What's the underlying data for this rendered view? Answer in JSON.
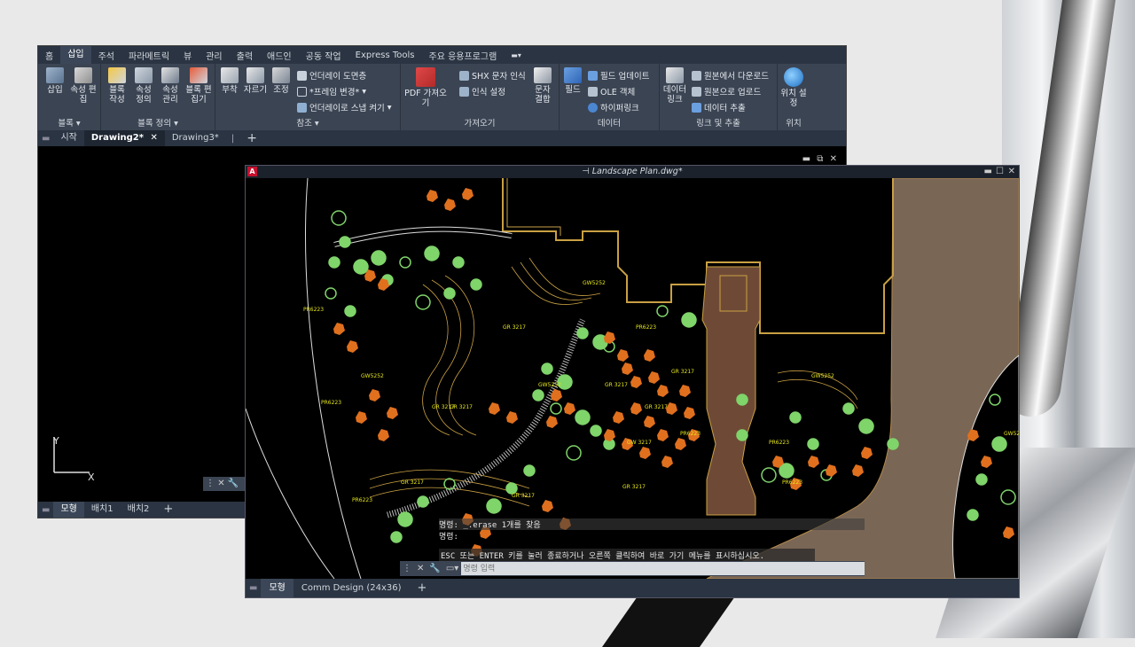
{
  "window1": {
    "menu_tabs": [
      "홈",
      "삽입",
      "주석",
      "파라메트릭",
      "뷰",
      "관리",
      "출력",
      "애드인",
      "공동 작업",
      "Express Tools",
      "주요 응용프로그램"
    ],
    "active_menu": "삽입",
    "ribbon": {
      "block_group": {
        "label": "블록",
        "buttons": [
          "삽입",
          "속성 편집"
        ]
      },
      "block_def_group": {
        "label": "블록 정의",
        "buttons": [
          "블록 작성",
          "속성 정의",
          "속성 관리",
          "블록 편집기"
        ]
      },
      "ref_group": {
        "label": "참조",
        "buttons": [
          "부착",
          "자르기",
          "조정"
        ],
        "small_items": [
          "언더레이 도면층",
          "*프레임 변경*",
          "언더레이로 스냅 켜기"
        ]
      },
      "import_group": {
        "label": "가져오기",
        "buttons": [
          "PDF 가져오기"
        ],
        "small_items": [
          "SHX 문자 인식",
          "인식 설정"
        ],
        "extra_button": "문자 결합"
      },
      "data_group": {
        "label": "데이터",
        "buttons": [
          "필드"
        ],
        "small_items": [
          "필드 업데이트",
          "OLE 객체",
          "하이퍼링크"
        ]
      },
      "link_group": {
        "label": "링크 및 추출",
        "buttons": [
          "데이터 링크"
        ],
        "small_items": [
          "원본에서 다운로드",
          "원본으로 업로드",
          "데이터 추출"
        ]
      },
      "location_group": {
        "label": "위치",
        "buttons": [
          "위치 설정"
        ]
      }
    },
    "doc_tabs": [
      "시작",
      "Drawing2*",
      "Drawing3*"
    ],
    "active_doc_tab": "Drawing2*",
    "bottom_tabs": [
      "모형",
      "배치1",
      "배치2"
    ],
    "axis_y": "Y",
    "axis_x": "X"
  },
  "window2": {
    "title": "Landscape Plan.dwg*",
    "command_history": [
      "명령: _.erase 1개를 찾음",
      "명령:",
      "ESC 또는 ENTER 키를 눌러 종료하거나 오른쪽 클릭하여 바로 가기 메뉴를 표시하십시오."
    ],
    "command_placeholder": "명령 입력",
    "bottom_tabs": [
      "모형",
      "Comm Design (24x36)"
    ],
    "labels": [
      "PR6223",
      "GW5252",
      "GR 3217",
      "GW5252",
      "GR 3217",
      "PR6223",
      "GR 3217",
      "GW5252",
      "PR6223",
      "GR 3217",
      "PR6223",
      "GR 3217",
      "GR 3217",
      "GW5252",
      "PR6223",
      "GW 3217",
      "GR 3217",
      "PR6223",
      "GR 3217",
      "PR6223",
      "GW5252",
      "GR 3217"
    ]
  },
  "colors": {
    "tree": "#7fd46a",
    "shrub": "#e0701e",
    "building": "#c9a043",
    "path": "#7a6655",
    "text": "#e6e61e"
  }
}
